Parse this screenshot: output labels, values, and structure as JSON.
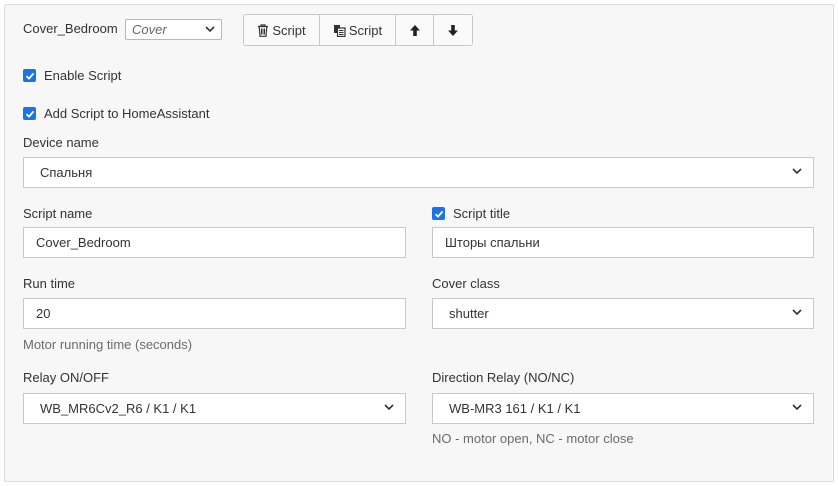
{
  "header": {
    "name": "Cover_Bedroom",
    "type_value": "Cover",
    "buttons": {
      "delete_label": "Script",
      "copy_label": "Script"
    }
  },
  "enable_script": {
    "label": "Enable Script",
    "checked": true
  },
  "add_to_ha": {
    "label": "Add Script to HomeAssistant",
    "checked": true
  },
  "device_name": {
    "label": "Device name",
    "value": "Спальня"
  },
  "script_name": {
    "label": "Script name",
    "value": "Cover_Bedroom"
  },
  "script_title": {
    "label": "Script title",
    "checked": true,
    "value": "Шторы спальни"
  },
  "run_time": {
    "label": "Run time",
    "value": "20",
    "help": "Motor running time (seconds)"
  },
  "cover_class": {
    "label": "Cover class",
    "value": "shutter"
  },
  "relay_on_off": {
    "label": "Relay ON/OFF",
    "value": "WB_MR6Cv2_R6 / K1 / K1"
  },
  "direction_relay": {
    "label": "Direction Relay (NO/NC)",
    "value": "WB-MR3 161 / K1 / K1",
    "help": "NO - motor open, NC - motor close"
  },
  "icons": [
    "trash-icon",
    "copy-icon",
    "arrow-up-icon",
    "arrow-down-icon",
    "chevron-down-icon",
    "checkmark-icon"
  ],
  "colors": {
    "checkbox": "#1a73e8",
    "panel_bg": "#f7f7f7",
    "border": "#c9c9c9"
  }
}
